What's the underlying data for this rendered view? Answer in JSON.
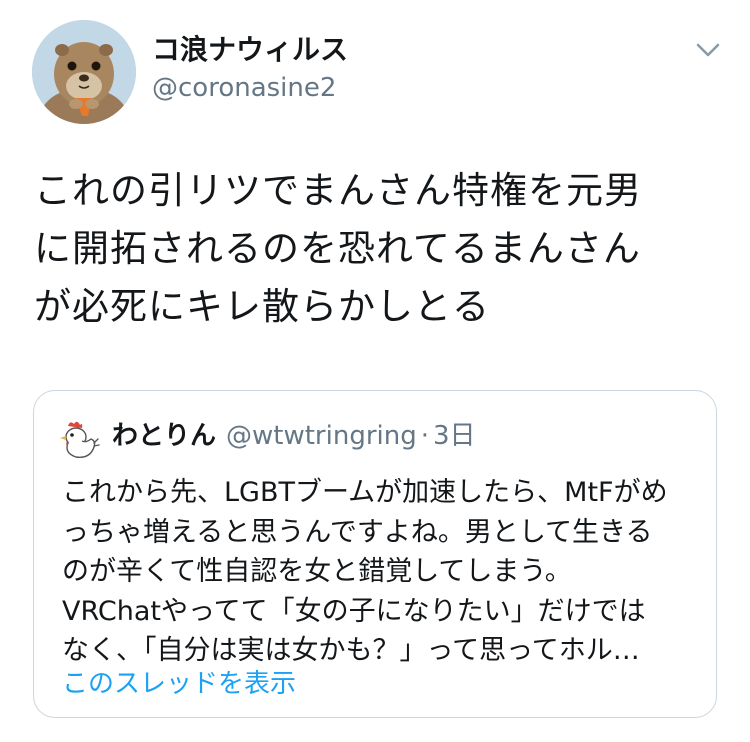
{
  "tweet": {
    "author_name": "コ浪ナウィルス",
    "author_handle": "@coronasine2",
    "text": "これの引リツでまんさん特権を元男\nに開拓されるのを恐れてるまんさん\nが必死にキレ散らかしとる",
    "menu_icon": "chevron-down-icon"
  },
  "quoted": {
    "author_name": "わとりん",
    "author_handle": "@wtwtringring",
    "separator": "·",
    "time": "3日",
    "text": "これから先、LGBTブームが加速したら、MtFがめ\nっちゃ増えると思うんですよね。男として生きる\nのが辛くて性自認を女と錯覚してしまう。\nVRChatやってて「女の子になりたい」だけでは\nなく、「自分は実は女かも？」って思ってホル…",
    "show_thread": "このスレッドを表示",
    "avatar_icon": "chicken-icon"
  },
  "colors": {
    "text": "#14171a",
    "secondary": "#657786",
    "link": "#1da1f2",
    "border": "#ccd6dd"
  }
}
